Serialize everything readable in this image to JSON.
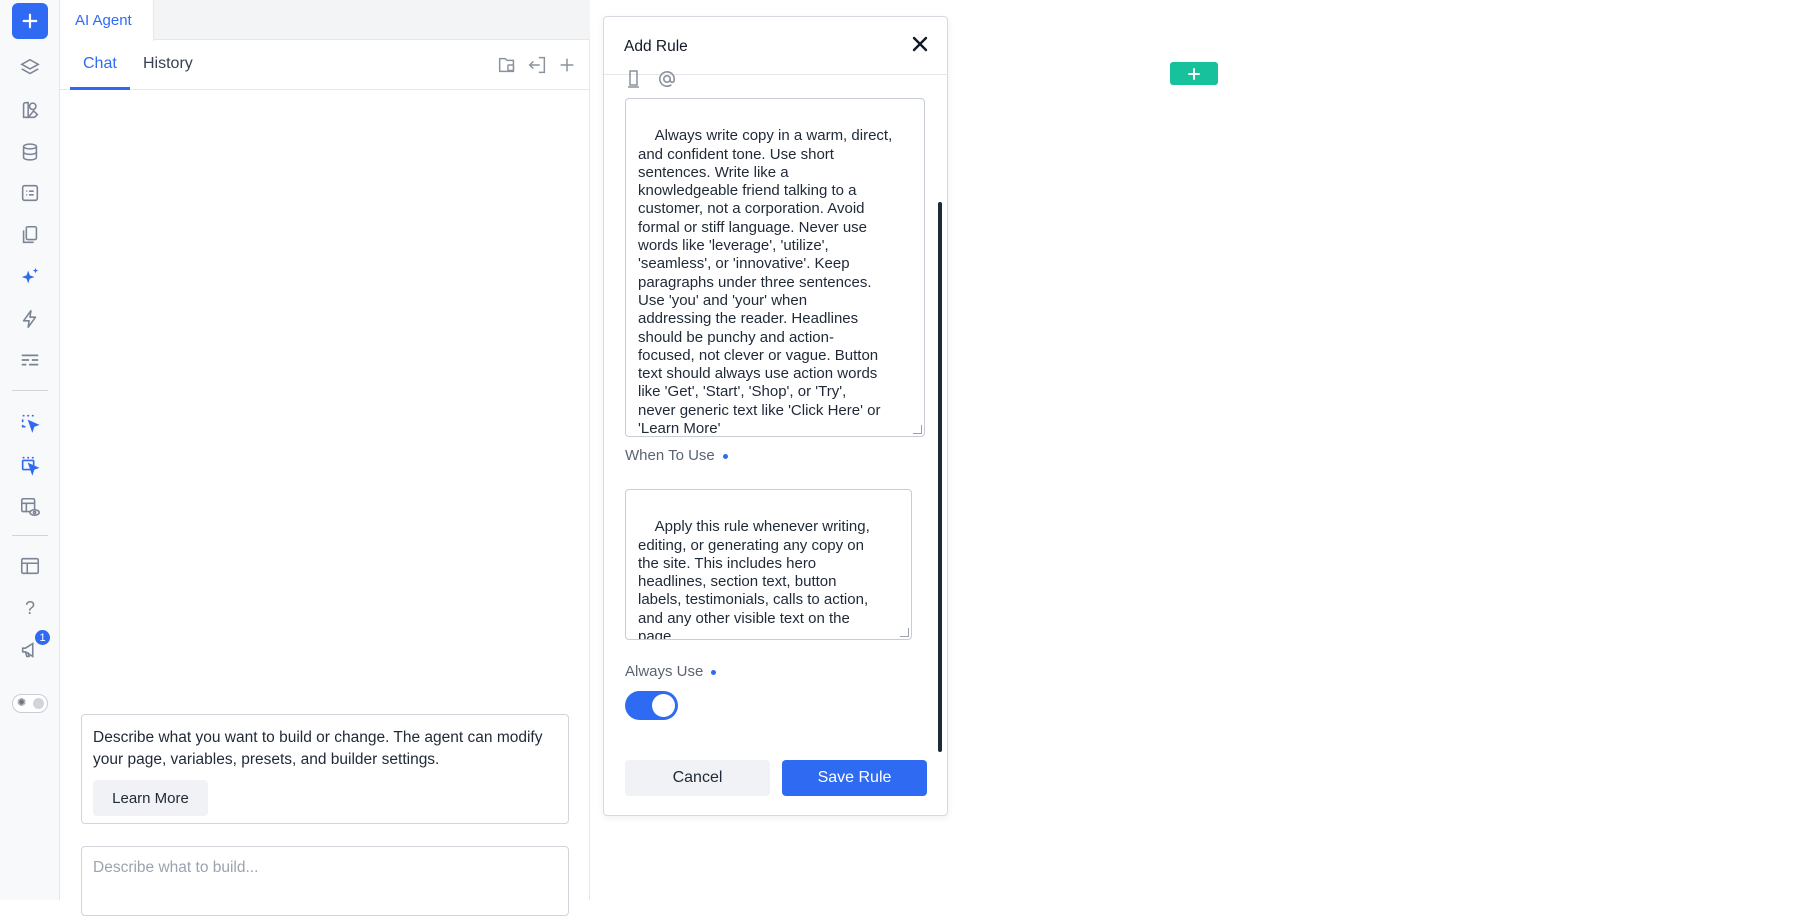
{
  "colors": {
    "accent": "#2f6bf2",
    "canvas_add": "#17c19b"
  },
  "rail": {
    "items": [
      {
        "name": "add-icon"
      },
      {
        "name": "layers-icon"
      },
      {
        "name": "components-icon"
      },
      {
        "name": "database-icon"
      },
      {
        "name": "form-icon"
      },
      {
        "name": "pages-icon"
      },
      {
        "name": "ai-sparkle-icon"
      },
      {
        "name": "lightning-icon"
      },
      {
        "name": "settings-lines-icon"
      },
      {
        "name": "select-pointer-icon"
      },
      {
        "name": "select-pointer-alt-icon"
      },
      {
        "name": "preview-icon"
      },
      {
        "name": "templates-icon"
      },
      {
        "name": "help-icon"
      },
      {
        "name": "megaphone-icon"
      }
    ],
    "help_glyph": "?",
    "notification_count": "1"
  },
  "agent_panel": {
    "tab_label": "AI Agent",
    "subtabs": [
      "Chat",
      "History"
    ],
    "info_text": "Describe what you want to build or change. The agent can modify your page, variables, presets, and builder settings.",
    "learn_more": "Learn More",
    "prompt_placeholder": "Describe what to build..."
  },
  "modal": {
    "title": "Add Rule",
    "content_text": "Always write copy in a warm, direct,\nand confident tone. Use short\nsentences. Write like a\nknowledgeable friend talking to a\ncustomer, not a corporation. Avoid\nformal or stiff language. Never use\nwords like 'leverage', 'utilize',\n'seamless', or 'innovative'. Keep\nparagraphs under three sentences.\nUse 'you' and 'your' when\naddressing the reader. Headlines\nshould be punchy and action-\nfocused, not clever or vague. Button\ntext should always use action words\nlike 'Get', 'Start', 'Shop', or 'Try',\nnever generic text like 'Click Here' or\n'Learn More'",
    "when_label": "When To Use",
    "when_text": "Apply this rule whenever writing,\nediting, or generating any copy on\nthe site. This includes hero\nheadlines, section text, button\nlabels, testimonials, calls to action,\nand any other visible text on the\npage.",
    "always_label": "Always Use",
    "always_on": true,
    "cancel_label": "Cancel",
    "save_label": "Save Rule"
  }
}
